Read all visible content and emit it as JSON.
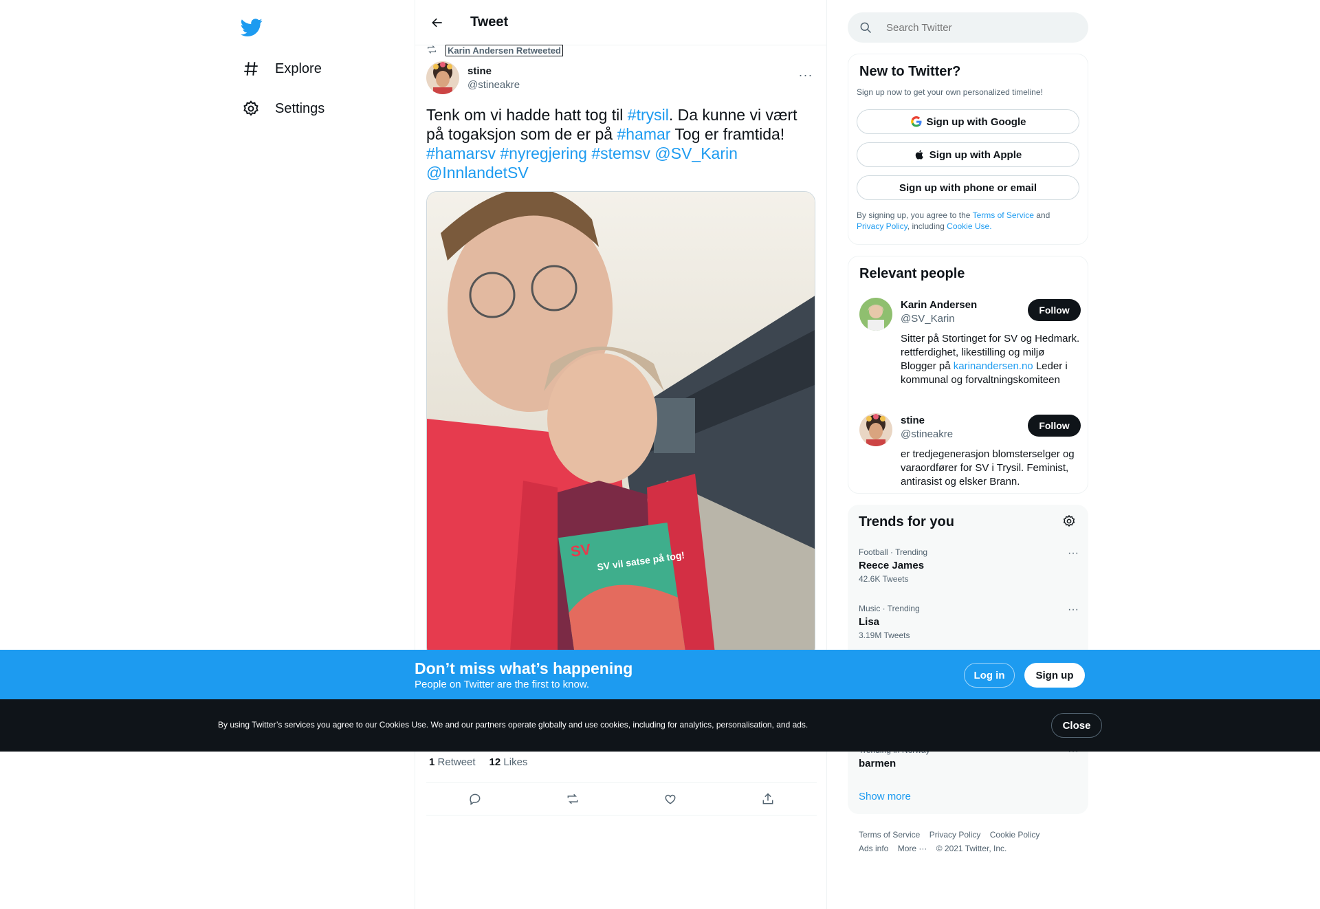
{
  "nav": {
    "logo": "twitter-bird-icon",
    "items": [
      {
        "label": "Explore",
        "icon": "hashtag-icon"
      },
      {
        "label": "Settings",
        "icon": "gear-icon"
      }
    ]
  },
  "header": {
    "title": "Tweet",
    "back_icon": "arrow-left-icon"
  },
  "tweet": {
    "retweet_context": "Karin Andersen Retweeted",
    "author_name": "stine",
    "author_handle": "@stineakre",
    "text_segments": [
      {
        "text": "Tenk om vi hadde hatt tog til ",
        "link": false
      },
      {
        "text": "#trysil",
        "link": true
      },
      {
        "text": ". Da kunne vi vært på togaksjon som de er på ",
        "link": false
      },
      {
        "text": "#hamar",
        "link": true
      },
      {
        "text": " Tog er framtida! ",
        "link": false
      },
      {
        "text": "#hamarsv",
        "link": true
      },
      {
        "text": " ",
        "link": false
      },
      {
        "text": "#nyregjering",
        "link": true
      },
      {
        "text": " ",
        "link": false
      },
      {
        "text": "#stemsv",
        "link": true
      },
      {
        "text": " ",
        "link": false
      },
      {
        "text": "@SV_Karin",
        "link": true
      },
      {
        "text": " ",
        "link": false
      },
      {
        "text": "@InnlandetSV",
        "link": true
      }
    ],
    "photo_sign": "SV vil satse på tog!",
    "retweets_count": "1",
    "retweets_label": "Retweet",
    "likes_count": "12",
    "likes_label": "Likes"
  },
  "search": {
    "placeholder": "Search Twitter"
  },
  "new_to_twitter": {
    "title": "New to Twitter?",
    "subtitle": "Sign up now to get your own personalized timeline!",
    "google_label": "Sign up with Google",
    "apple_label": "Sign up with Apple",
    "phone_label": "Sign up with phone or email",
    "legal_pre": "By signing up, you agree to the ",
    "terms": "Terms of Service",
    "and": " and ",
    "privacy": "Privacy Policy",
    "including": ", including ",
    "cookie": "Cookie Use."
  },
  "relevant_people": {
    "title": "Relevant people",
    "people": [
      {
        "name": "Karin Andersen",
        "handle": "@SV_Karin",
        "bio_pre": "Sitter på Stortinget for SV og Hedmark. rettferdighet, likestilling og miljø Blogger på ",
        "bio_link": "karinandersen.no",
        "bio_post": " Leder i kommunal og forvaltningskomiteen",
        "follow": "Follow"
      },
      {
        "name": "stine",
        "handle": "@stineakre",
        "bio_pre": "er tredjegenerasjon blomsterselger og varaordfører for SV i Trysil. Feminist, antirasist og elsker Brann.",
        "bio_link": "",
        "bio_post": "",
        "follow": "Follow"
      }
    ]
  },
  "trends": {
    "title": "Trends for you",
    "items": [
      {
        "meta": "Football · Trending",
        "name": "Reece James",
        "count": "42.6K Tweets"
      },
      {
        "meta": "Music · Trending",
        "name": "Lisa",
        "count": "3.19M Tweets"
      },
      {
        "meta": "Trending in Norway",
        "name": "barmen",
        "count": ""
      }
    ],
    "show_more": "Show more"
  },
  "footer": {
    "links": [
      "Terms of Service",
      "Privacy Policy",
      "Cookie Policy",
      "Ads info",
      "More ···",
      "© 2021 Twitter, Inc."
    ]
  },
  "signup_banner": {
    "headline": "Don’t miss what’s happening",
    "subtitle": "People on Twitter are the first to know.",
    "login": "Log in",
    "signup": "Sign up"
  },
  "cookie_banner": {
    "text": "By using Twitter’s services you agree to our Cookies Use. We and our partners operate globally and use cookies, including for analytics, personalisation, and ads.",
    "close": "Close"
  },
  "colors": {
    "accent": "#1d9bf0",
    "text": "#0f1419",
    "muted": "#536471",
    "dark_banner": "#0f1419"
  }
}
